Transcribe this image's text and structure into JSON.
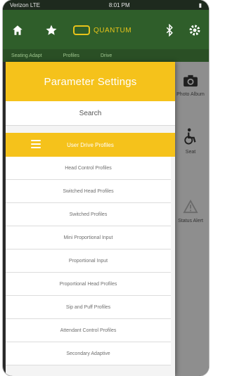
{
  "statusbar": {
    "carrier": "Verizon LTE",
    "time": "8:01 PM"
  },
  "appbar": {
    "home_icon": "home-icon",
    "star_icon": "star-icon",
    "brand": "QUANTUM",
    "bluetooth_icon": "bluetooth-icon",
    "settings_icon": "gear-icon"
  },
  "tabs": [
    "Seating Adapt",
    "Profiles",
    "Drive"
  ],
  "right_panel": [
    {
      "icon": "camera-icon",
      "label": "Photo Album"
    },
    {
      "icon": "wheelchair-icon",
      "label": "Seat"
    },
    {
      "icon": "warning-icon",
      "label": "Status Alert"
    }
  ],
  "drawer": {
    "title": "Parameter Settings",
    "search_label": "Search",
    "active_item": "User Drive Profiles",
    "items": [
      "Head Control Profiles",
      "Switched Head Profiles",
      "Switched Profiles",
      "Mini Proportional Input",
      "Proportional Input",
      "Proportional Head Profiles",
      "Sip and Puff Profiles",
      "Attendant Control Profiles",
      "Secondary Adaptive"
    ]
  },
  "colors": {
    "accent": "#f5c21b",
    "appbar": "#2f5e2a"
  }
}
